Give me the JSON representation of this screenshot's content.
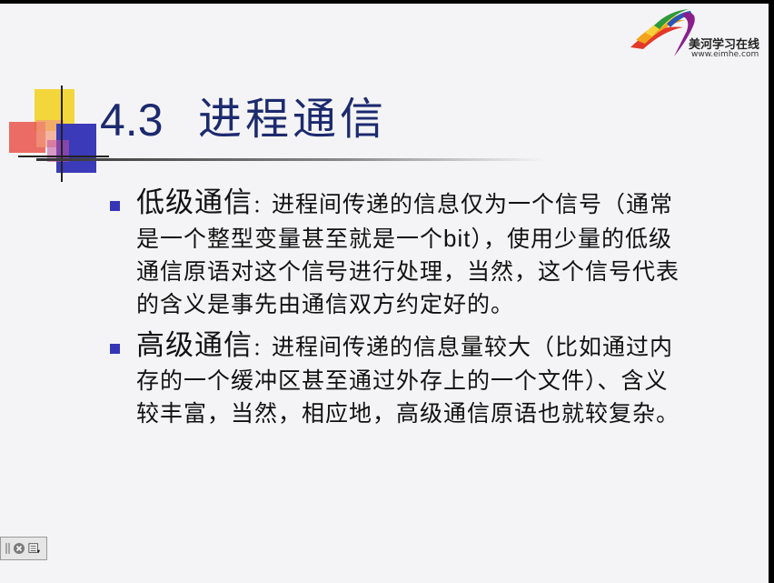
{
  "logo": {
    "name": "美河学习在线",
    "url": "www.eimhe.com"
  },
  "title": {
    "number": "4.3",
    "text": "进程通信"
  },
  "items": [
    {
      "head": "低级通信",
      "colon": "：",
      "line1": "进程间传递的信息仅为一个信号（通常",
      "line2_pre": "是一个整型变量甚至就是一个",
      "line2_eng": "bit",
      "line2_post": "），使用少量的低级",
      "line3": "通信原语对这个信号进行处理，当然，这个信号代表",
      "line4": "的含义是事先由通信双方约定好的。"
    },
    {
      "head": "高级通信",
      "colon": "：",
      "line1": "进程间传递的信息量较大（比如通过内",
      "line2": "存的一个缓冲区甚至通过外存上的一个文件）、含义",
      "line3": "较丰富，当然，相应地，高级通信原语也就较复杂。"
    }
  ],
  "colors": {
    "title": "#1c2a6e",
    "bullet": "#3535b6",
    "background": "#f4f4f6"
  }
}
